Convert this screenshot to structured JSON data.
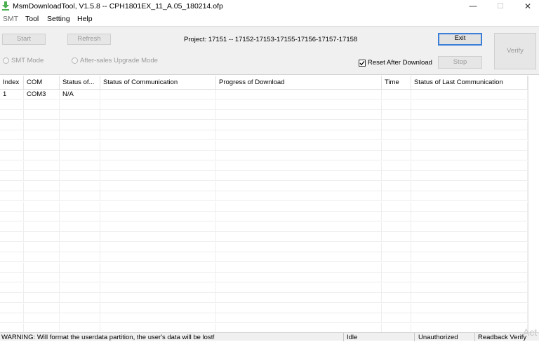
{
  "window": {
    "title": "MsmDownloadTool, V1.5.8 -- CPH1801EX_11_A.05_180214.ofp",
    "minimize_glyph": "—",
    "maximize_glyph": "☐",
    "close_glyph": "✕"
  },
  "menu": [
    "SMT",
    "Tool",
    "Setting",
    "Help"
  ],
  "toolbar": {
    "start_label": "Start",
    "refresh_label": "Refresh",
    "project_text": "Project: 17151 -- 17152-17153-17155-17156-17157-17158",
    "exit_label": "Exit",
    "stop_label": "Stop",
    "verify_label": "Verify",
    "smt_mode_label": "SMT Mode",
    "aftersales_label": "After-sales Upgrade Mode",
    "reset_after_download_label": "Reset After Download",
    "reset_after_download_checked": true
  },
  "table": {
    "columns": [
      "Index",
      "COM",
      "Status of...",
      "Status of Communication",
      "Progress of Download",
      "Time",
      "Status of Last Communication"
    ],
    "rows": [
      [
        "1",
        "COM3",
        "N/A",
        "",
        "",
        "",
        ""
      ]
    ]
  },
  "status_bar": {
    "warning": "WARNING: Will format the userdata partition, the user's data will be lost!",
    "state": "Idle",
    "auth": "Unauthorized",
    "readback": "Readback Verify"
  },
  "watermark": "Act",
  "colors": {
    "icon_green": "#4caf50",
    "focus_blue": "#3c7fd8",
    "disabled_text": "#9b9b9b"
  }
}
